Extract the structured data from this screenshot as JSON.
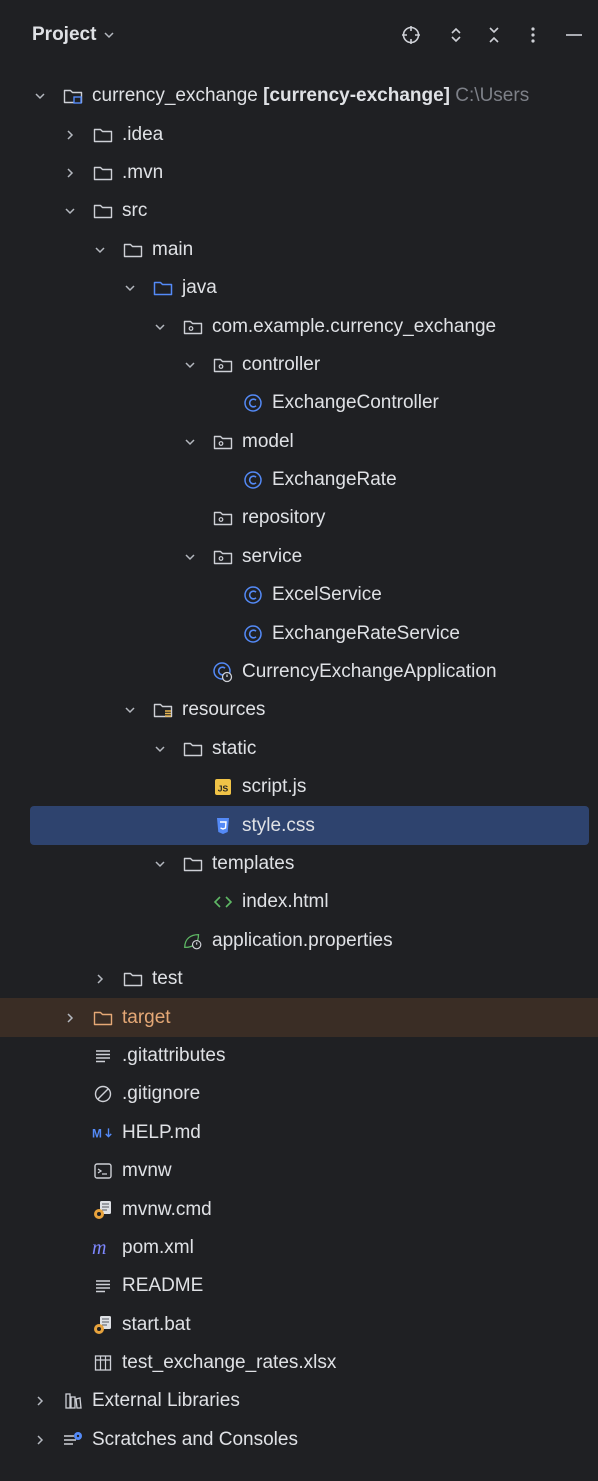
{
  "panel": {
    "title": "Project"
  },
  "header_icons": [
    "target-icon",
    "expand-icon",
    "collapse-icon",
    "kebab-icon",
    "minimize-icon"
  ],
  "tree": [
    {
      "name": "root",
      "depth": 0,
      "expanded": true,
      "icon": "module-folder",
      "label": "currency_exchange",
      "bold": "[currency-exchange]",
      "dim": "C:\\Users"
    },
    {
      "name": "idea",
      "depth": 1,
      "expanded": false,
      "icon": "folder",
      "label": ".idea"
    },
    {
      "name": "mvn",
      "depth": 1,
      "expanded": false,
      "icon": "folder",
      "label": ".mvn"
    },
    {
      "name": "src",
      "depth": 1,
      "expanded": true,
      "icon": "folder",
      "label": "src"
    },
    {
      "name": "main",
      "depth": 2,
      "expanded": true,
      "icon": "folder",
      "label": "main"
    },
    {
      "name": "java",
      "depth": 3,
      "expanded": true,
      "icon": "source-folder",
      "label": "java"
    },
    {
      "name": "package",
      "depth": 4,
      "expanded": true,
      "icon": "package",
      "label": "com.example.currency_exchange"
    },
    {
      "name": "controller",
      "depth": 5,
      "expanded": true,
      "icon": "package",
      "label": "controller"
    },
    {
      "name": "exchange-controller",
      "depth": 6,
      "expanded": null,
      "icon": "class",
      "label": "ExchangeController"
    },
    {
      "name": "model",
      "depth": 5,
      "expanded": true,
      "icon": "package",
      "label": "model"
    },
    {
      "name": "exchange-rate",
      "depth": 6,
      "expanded": null,
      "icon": "class",
      "label": "ExchangeRate"
    },
    {
      "name": "repository",
      "depth": 5,
      "expanded": null,
      "icon": "package",
      "label": "repository"
    },
    {
      "name": "service",
      "depth": 5,
      "expanded": true,
      "icon": "package",
      "label": "service"
    },
    {
      "name": "excel-service",
      "depth": 6,
      "expanded": null,
      "icon": "class",
      "label": "ExcelService"
    },
    {
      "name": "exchange-rate-service",
      "depth": 6,
      "expanded": null,
      "icon": "class",
      "label": "ExchangeRateService"
    },
    {
      "name": "application-class",
      "depth": 5,
      "expanded": null,
      "icon": "spring-class",
      "label": "CurrencyExchangeApplication"
    },
    {
      "name": "resources",
      "depth": 3,
      "expanded": true,
      "icon": "resources-folder",
      "label": "resources"
    },
    {
      "name": "static",
      "depth": 4,
      "expanded": true,
      "icon": "folder",
      "label": "static"
    },
    {
      "name": "script-js",
      "depth": 5,
      "expanded": null,
      "icon": "js-file",
      "label": "script.js"
    },
    {
      "name": "style-css",
      "depth": 5,
      "expanded": null,
      "icon": "css-file",
      "label": "style.css",
      "selected": true
    },
    {
      "name": "templates",
      "depth": 4,
      "expanded": true,
      "icon": "folder",
      "label": "templates"
    },
    {
      "name": "index-html",
      "depth": 5,
      "expanded": null,
      "icon": "html-file",
      "label": "index.html"
    },
    {
      "name": "application-properties",
      "depth": 4,
      "expanded": null,
      "icon": "spring-properties",
      "label": "application.properties"
    },
    {
      "name": "test",
      "depth": 2,
      "expanded": false,
      "icon": "folder",
      "label": "test"
    },
    {
      "name": "target",
      "depth": 1,
      "expanded": false,
      "icon": "excluded-folder",
      "label": "target",
      "excluded": true
    },
    {
      "name": "gitattributes",
      "depth": 1,
      "expanded": null,
      "icon": "text-file",
      "label": ".gitattributes"
    },
    {
      "name": "gitignore",
      "depth": 1,
      "expanded": null,
      "icon": "ignore-file",
      "label": ".gitignore"
    },
    {
      "name": "help-md",
      "depth": 1,
      "expanded": null,
      "icon": "markdown-file",
      "label": "HELP.md"
    },
    {
      "name": "mvnw",
      "depth": 1,
      "expanded": null,
      "icon": "shell-file",
      "label": "mvnw"
    },
    {
      "name": "mvnw-cmd",
      "depth": 1,
      "expanded": null,
      "icon": "batch-file",
      "label": "mvnw.cmd"
    },
    {
      "name": "pom-xml",
      "depth": 1,
      "expanded": null,
      "icon": "maven-file",
      "label": "pom.xml"
    },
    {
      "name": "readme",
      "depth": 1,
      "expanded": null,
      "icon": "text-file",
      "label": "README"
    },
    {
      "name": "start-bat",
      "depth": 1,
      "expanded": null,
      "icon": "batch-file",
      "label": "start.bat"
    },
    {
      "name": "xlsx-file",
      "depth": 1,
      "expanded": null,
      "icon": "table-file",
      "label": "test_exchange_rates.xlsx"
    },
    {
      "name": "external-libraries",
      "depth": 0,
      "expanded": false,
      "icon": "libraries",
      "label": "External Libraries"
    },
    {
      "name": "scratches",
      "depth": 0,
      "expanded": false,
      "icon": "scratches",
      "label": "Scratches and Consoles"
    }
  ],
  "colors": {
    "background": "#1f2023",
    "text": "#dfe1e5",
    "selection": "#2e436e",
    "excluded_row": "#3a2d25",
    "excluded_text": "#e5a876",
    "class_blue": "#548af7",
    "dim": "#7d8088"
  }
}
